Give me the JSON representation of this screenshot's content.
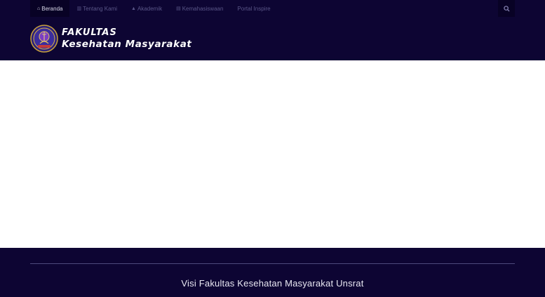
{
  "nav": {
    "items": [
      {
        "label": "Beranda",
        "icon": "home-icon",
        "active": true
      },
      {
        "label": "Tentang Kami",
        "icon": "building-icon",
        "active": false
      },
      {
        "label": "Akademik",
        "icon": "graduation-cap-icon",
        "active": false
      },
      {
        "label": "Kemahasiswaan",
        "icon": "document-icon",
        "active": false
      },
      {
        "label": "Portal Inspire",
        "icon": "",
        "active": false
      }
    ],
    "search_icon": "search-icon"
  },
  "brand": {
    "line1": "FAKULTAS",
    "line2": "Kesehatan Masyarakat"
  },
  "footer": {
    "visi_title": "Visi Fakultas Kesehatan Masyarakat Unsrat"
  },
  "colors": {
    "header_bg": "#0d0533",
    "nav_active_bg": "#080225",
    "nav_text": "#5a5688",
    "footer_bg": "#0d0533"
  }
}
